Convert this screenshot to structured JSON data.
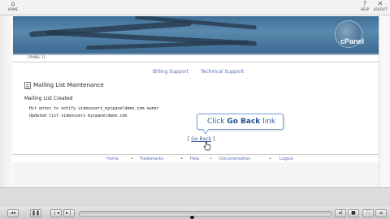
{
  "toolbar": {
    "home_label": "HOME",
    "help_label": "HELP",
    "logout_label": "LOGOUT"
  },
  "banner": {
    "logo_text": "cPanel"
  },
  "breadcrumb": {
    "text": "CPANEL 11"
  },
  "support_links": {
    "billing": "Billing Support",
    "technical": "Technical Support"
  },
  "section": {
    "title": "Mailing List Maintenance",
    "status": "Mailing List Created",
    "line1": "Hit enter to notify videousers_mycpaneldemo.com owner",
    "line2": "Updated list videousers mycpaneldemo.com"
  },
  "go_back": {
    "bracket_open": "[",
    "label": "Go Back",
    "bracket_close": "]"
  },
  "callout": {
    "prefix": "Click",
    "bold": "Go Back",
    "suffix": "link"
  },
  "footer_nav": {
    "items": [
      "Home",
      "Trademarks",
      "Help",
      "Documentation",
      "Logout"
    ],
    "separator": "•"
  },
  "player": {
    "icons": [
      "rewind-icon",
      "pause-icon",
      "previous-icon",
      "next-icon",
      "volume-icon",
      "stop-icon",
      "fullscreen-icon",
      "menu-icon"
    ]
  }
}
